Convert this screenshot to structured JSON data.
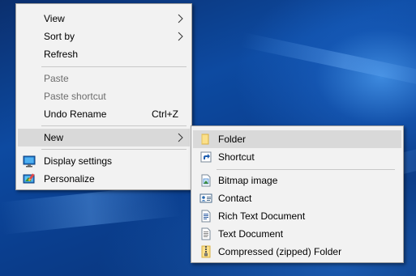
{
  "context_menu": {
    "items": [
      {
        "label": "View"
      },
      {
        "label": "Sort by"
      },
      {
        "label": "Refresh"
      },
      {
        "label": "Paste"
      },
      {
        "label": "Paste shortcut"
      },
      {
        "label": "Undo Rename",
        "shortcut": "Ctrl+Z"
      },
      {
        "label": "New"
      },
      {
        "label": "Display settings",
        "icon": "display-settings-icon"
      },
      {
        "label": "Personalize",
        "icon": "personalize-icon"
      }
    ]
  },
  "new_submenu": {
    "items": [
      {
        "label": "Folder",
        "icon": "folder-icon"
      },
      {
        "label": "Shortcut",
        "icon": "shortcut-icon"
      },
      {
        "label": "Bitmap image",
        "icon": "bitmap-icon"
      },
      {
        "label": "Contact",
        "icon": "contact-icon"
      },
      {
        "label": "Rich Text Document",
        "icon": "rich-text-icon"
      },
      {
        "label": "Text Document",
        "icon": "text-document-icon"
      },
      {
        "label": "Compressed (zipped) Folder",
        "icon": "zip-folder-icon"
      }
    ]
  },
  "colors": {
    "menu_background": "#f2f2f2",
    "highlight": "#d9d9d9",
    "disabled_text": "#6d6d6d",
    "desktop_blue": "#0d4aa1"
  }
}
